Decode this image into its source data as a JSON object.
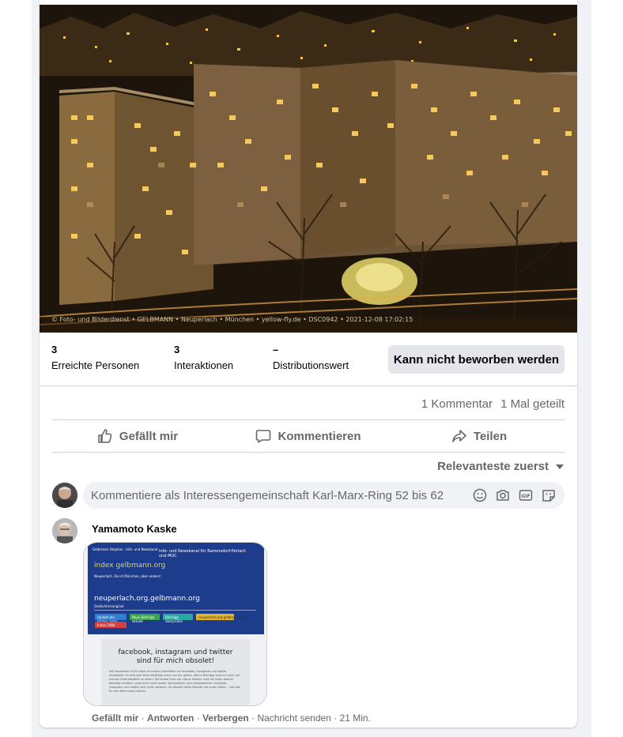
{
  "photo": {
    "caption": "© Foto- und Bilderdienst • GELBMANN • Neuperlach • München • yellow-fly.de • DSC0942 • 2021-12-08 17:02:15"
  },
  "stats": {
    "reach": {
      "value": "3",
      "label": "Erreichte Personen"
    },
    "interactions": {
      "value": "3",
      "label": "Interaktionen"
    },
    "distribution": {
      "value": "–",
      "label": "Distributionswert"
    },
    "boost_label": "Kann nicht beworben werden"
  },
  "counts": {
    "comments": "1 Kommentar",
    "shares": "1 Mal geteilt"
  },
  "actions": {
    "like": "Gefällt mir",
    "comment": "Kommentieren",
    "share": "Teilen"
  },
  "sort": {
    "label": "Relevanteste zuerst"
  },
  "composer": {
    "placeholder": "Kommentiere als Interessengemeinschaft Karl-Marx-Ring 52 bis 62"
  },
  "comment": {
    "author": "Yamamoto Kaske",
    "attachment": {
      "tiny_head": "Gelbmann Stephan · Info- und Newsband",
      "header": "Info- und Newskanal für Ramersdorf-Perlach und MUC",
      "title1": "index gelbmann.org",
      "sub1": "Neuperlach. Da ist München, aber anders!",
      "title2": "neuperlach.org.gelbmann.org",
      "sub2": "Gedächtnisoriginal",
      "pills": [
        "Update der letzten Seite",
        "Neue Beiträge aktuell",
        "Beiträge überprüfen",
        "neuperlach.org.gelbmann.org",
        "Index 1984"
      ],
      "heading": "facebook, instagram und twitter sind für mich obsolet!",
      "body": "Seit November 2020 habe ich meine Aktivitäten auf facebook, instagram und twitter eingestellt. Es wird dort keine Beiträge mehr von mir geben. Meine Beiträge sind nur noch auf meinen Internetseiten zu sehen. Mit einem Klick auf »Neue Seiten« sind die Index meiner Beiträge sichtbar. Lasst euch nicht weiter manipulieren und ausspionieren: facebook, instagram und twitter sind nicht umsonst. Ihr bezahlt diese Dienste mit euren Daten - und das für den Rest eures Lebens."
    },
    "footer": {
      "like": "Gefällt mir",
      "reply": "Antworten",
      "hide": "Verbergen",
      "send": "Nachricht senden",
      "time": "21 Min.",
      "sep": "·"
    }
  }
}
